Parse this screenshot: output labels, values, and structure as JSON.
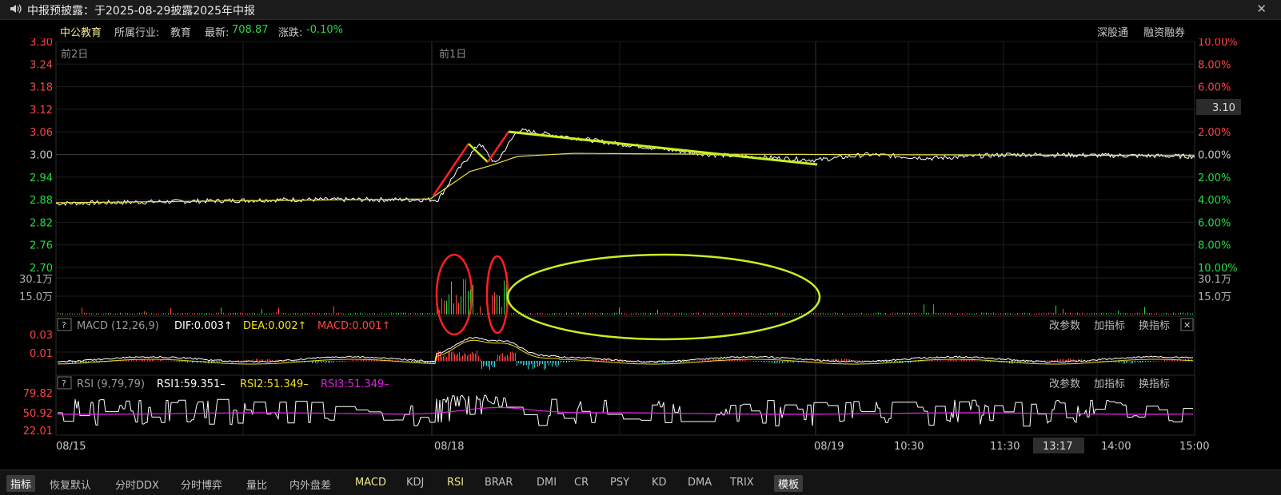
{
  "header": {
    "title": "中报预披露：于2025-08-29披露2025年中报",
    "speaker_icon": "speaker-icon",
    "close_glyph": "✕"
  },
  "stock": {
    "name": "中公教育",
    "industry_label": "所属行业:",
    "industry": "教育",
    "latest_label": "最新:",
    "latest": "708.87",
    "change_label": "涨跌:",
    "change": "-0.10%",
    "links": [
      "深股通",
      "融资融券"
    ]
  },
  "price_panel": {
    "day_labels": [
      "前2日",
      "前1日"
    ],
    "current_price_tag": "3.10"
  },
  "macd_panel": {
    "help": "?",
    "name": "MACD (12,26,9)",
    "dif": "DIF:0.003↑",
    "dea": "DEA:0.002↑",
    "macd": "MACD:0.001↑",
    "buttons": [
      "改参数",
      "加指标",
      "换指标"
    ],
    "close": "✕"
  },
  "rsi_panel": {
    "help": "?",
    "name": "RSI (9,79,79)",
    "rsi1": "RSI1:59.351–",
    "rsi2": "RSI2:51.349–",
    "rsi3": "RSI3:51.349–",
    "buttons": [
      "改参数",
      "加指标",
      "换指标"
    ]
  },
  "time_axis": {
    "cursor_time": "13:17"
  },
  "bottom_tabs": [
    "指标",
    "恢复默认",
    "分时DDX",
    "分时博弈",
    "量比",
    "内外盘差",
    "MACD",
    "KDJ",
    "RSI",
    "BRAR",
    "DMI",
    "CR",
    "PSY",
    "KD",
    "DMA",
    "TRIX",
    "模板"
  ],
  "colors": {
    "up": "#ff4444",
    "down": "#22dd44",
    "price_line": "#ffffff",
    "avg_line": "#e8e040",
    "annotation_red": "#ff2020",
    "annotation_green": "#c8f020",
    "cyan": "#30d0e0",
    "magenta": "#e020e0"
  },
  "chart_data": [
    {
      "type": "line",
      "name": "price",
      "x_ticks": [
        "08/15",
        "08/18",
        "08/19",
        "10:30",
        "11:30",
        "14:00",
        "15:00"
      ],
      "left_ticks": [
        "3.30",
        "3.24",
        "3.18",
        "3.12",
        "3.06",
        "3.00",
        "2.94",
        "2.88",
        "2.82",
        "2.76",
        "2.70"
      ],
      "right_ticks": [
        "10.00%",
        "8.00%",
        "6.00%",
        "4.00%",
        "2.00%",
        "0.00%",
        "2.00%",
        "4.00%",
        "6.00%",
        "8.00%",
        "10.00%"
      ],
      "ylim": [
        2.7,
        3.3
      ],
      "price_points": [
        [
          0,
          2.87
        ],
        [
          290,
          2.88
        ],
        [
          480,
          2.88
        ],
        [
          500,
          2.945
        ],
        [
          532,
          3.03
        ],
        [
          552,
          2.975
        ],
        [
          580,
          3.065
        ],
        [
          700,
          3.03
        ],
        [
          820,
          3.0
        ],
        [
          955,
          2.985
        ],
        [
          1020,
          3.0
        ],
        [
          1100,
          2.99
        ],
        [
          1200,
          3.0
        ],
        [
          1430,
          2.995
        ]
      ],
      "avg_points": [
        [
          0,
          2.872
        ],
        [
          470,
          2.882
        ],
        [
          520,
          2.955
        ],
        [
          545,
          2.97
        ],
        [
          580,
          2.995
        ],
        [
          650,
          3.003
        ],
        [
          800,
          3.001
        ],
        [
          1430,
          2.997
        ]
      ]
    },
    {
      "type": "bar",
      "name": "volume",
      "y_ticks": [
        "30.1万",
        "15.0万"
      ],
      "ylim": [
        0,
        301000
      ]
    },
    {
      "type": "bar",
      "name": "MACD",
      "y_ticks": [
        "0.03",
        "0.01"
      ]
    },
    {
      "type": "line",
      "name": "RSI",
      "y_ticks": [
        "79.82",
        "50.92",
        "22.01"
      ],
      "ylim": [
        22.01,
        79.82
      ]
    }
  ]
}
